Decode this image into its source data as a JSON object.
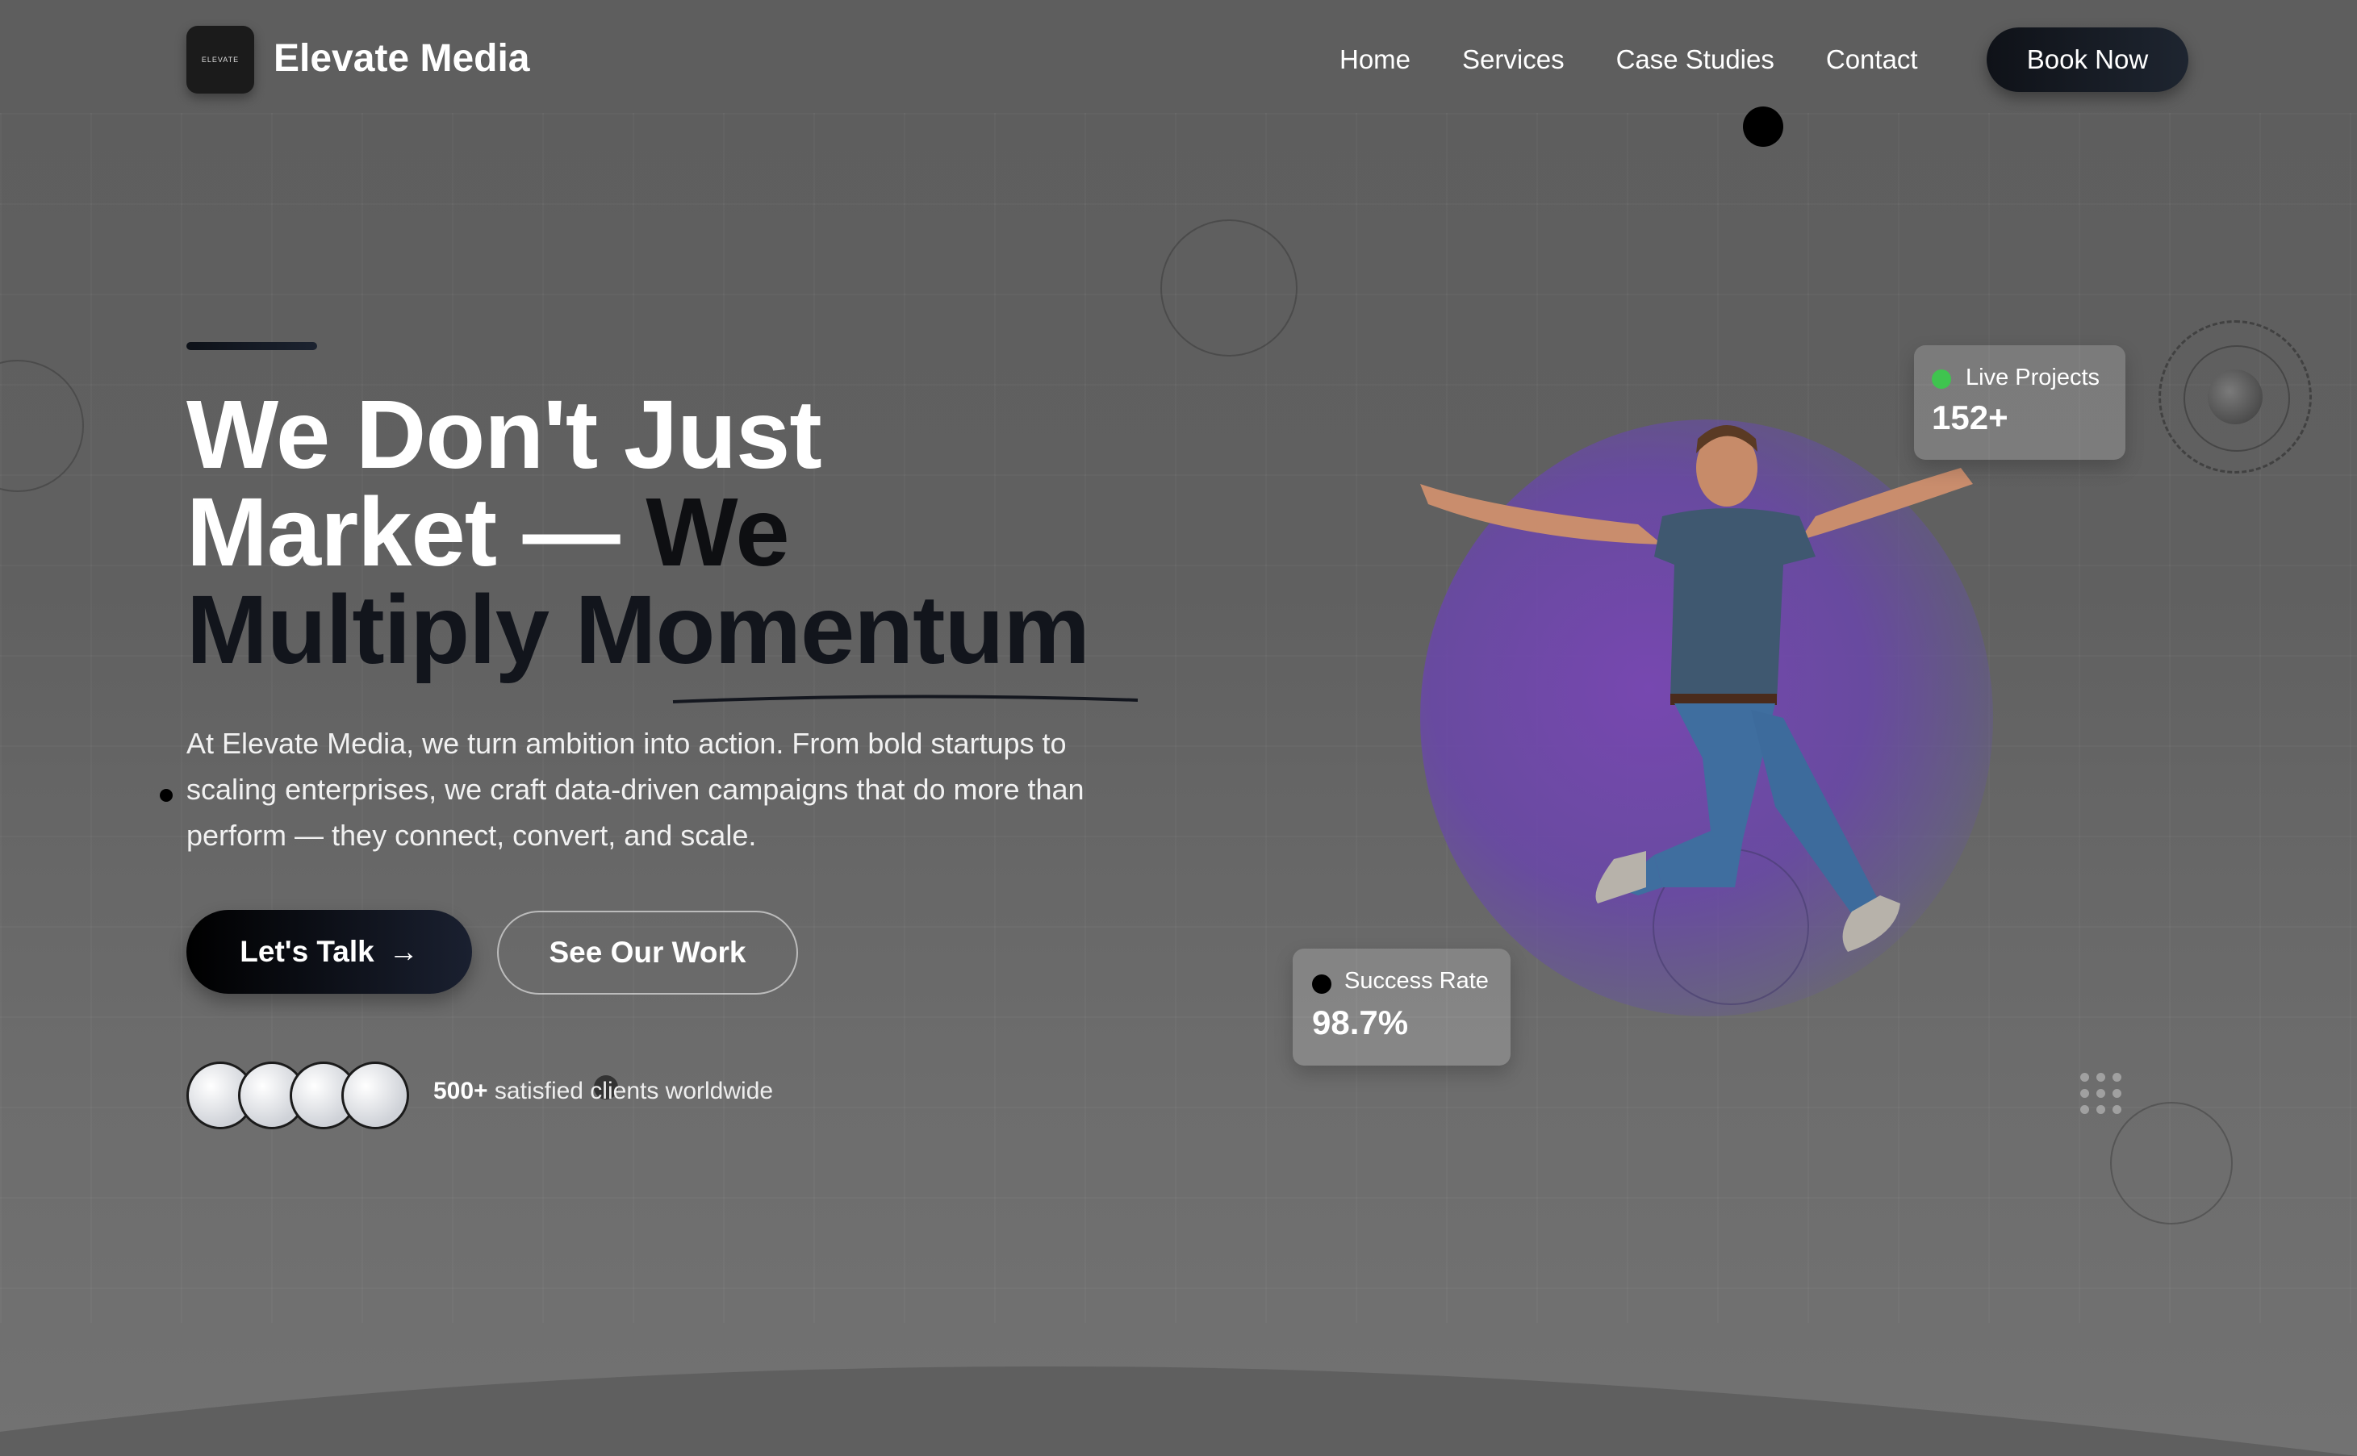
{
  "nav": {
    "logo_text": "ELEVATE",
    "brand": "Elevate Media",
    "links": [
      "Home",
      "Services",
      "Case Studies",
      "Contact"
    ],
    "cta": "Book Now"
  },
  "hero": {
    "headline_line1": "We Don't Just",
    "headline_line2a": "Market —",
    "headline_line2b": "We",
    "headline_line3": "Multiply Momentum",
    "lead": "At Elevate Media, we turn ambition into action. From bold startups to scaling enterprises, we craft data-driven campaigns that do more than perform — they connect, convert, and scale.",
    "btn_primary": "Let's Talk",
    "btn_primary_arrow": "→",
    "btn_secondary": "See Our Work",
    "clients_count": "500+",
    "clients_text": "satisfied clients worldwide"
  },
  "stats": {
    "live_label": "Live Projects",
    "live_value": "152+",
    "live_dot_color": "#3fc44f",
    "success_label": "Success Rate",
    "success_value": "98.7%",
    "success_dot_color": "#000000"
  },
  "colors": {
    "accent_dark": "#0e0f12",
    "glow_purple": "#7a48b4"
  }
}
